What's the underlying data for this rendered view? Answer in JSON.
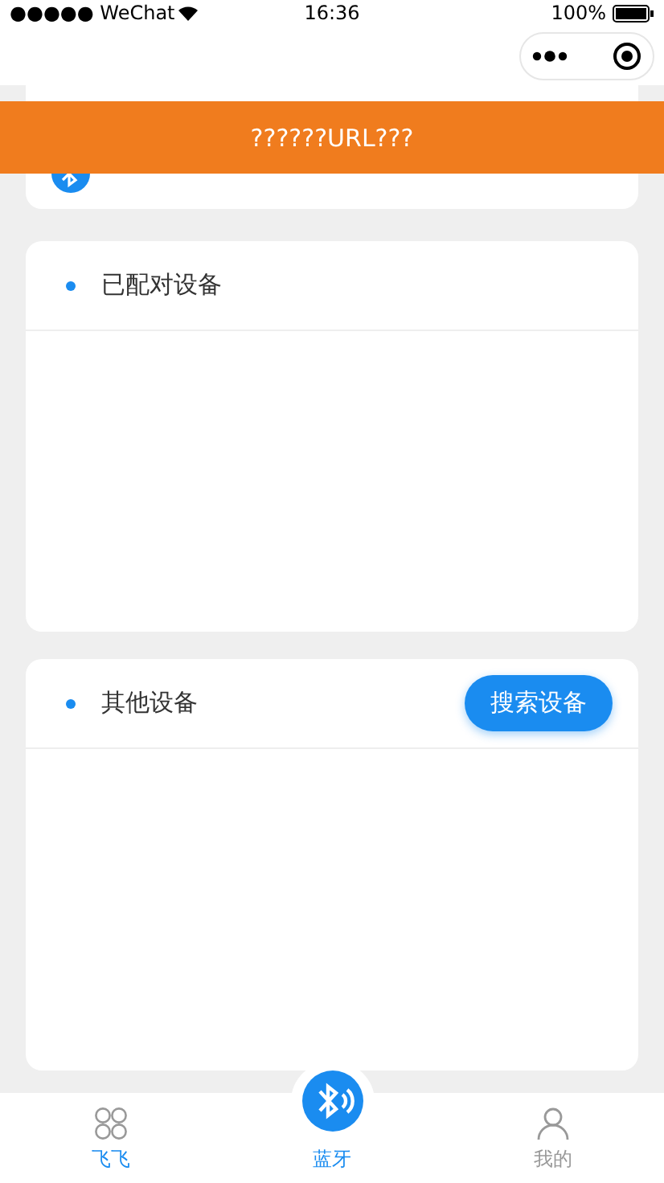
{
  "status_bar": {
    "carrier": "●●●●● WeChat",
    "time": "16:36",
    "battery": "100%"
  },
  "toast": {
    "message": "??????URL???"
  },
  "paired_section": {
    "title": "已配对设备"
  },
  "other_section": {
    "title": "其他设备",
    "button": "搜索设备"
  },
  "tabs": [
    {
      "label": "飞飞",
      "kind": "grid",
      "selected": false,
      "color": "#1a8cf0"
    },
    {
      "label": "蓝牙",
      "kind": "bluetooth",
      "selected": true,
      "color": "#1a8cf0"
    },
    {
      "label": "我的",
      "kind": "person",
      "selected": false,
      "color": "#999999"
    }
  ]
}
